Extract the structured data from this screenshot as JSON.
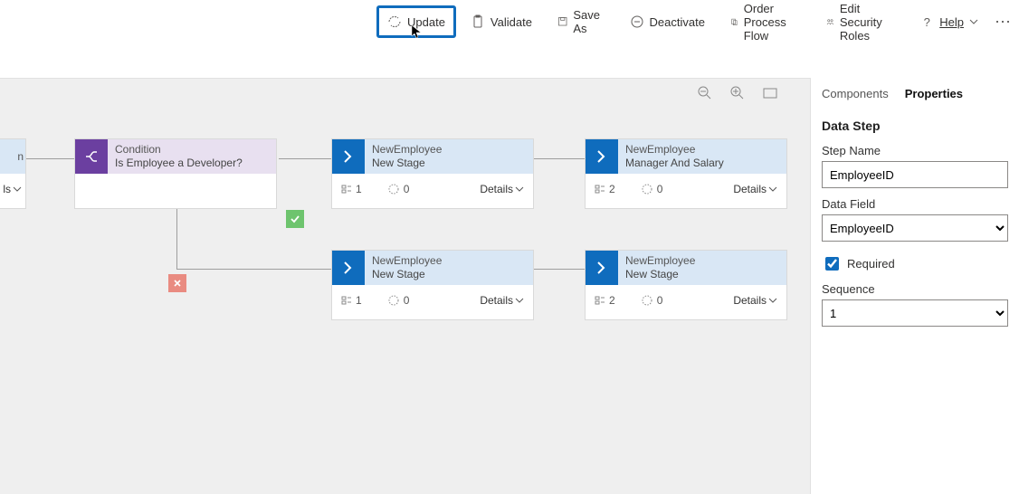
{
  "toolbar": {
    "update": "Update",
    "validate": "Validate",
    "save_as": "Save As",
    "deactivate": "Deactivate",
    "order": "Order Process Flow",
    "edit_roles": "Edit Security Roles",
    "help": "Help"
  },
  "canvas": {
    "partial_details": "ls",
    "condition": {
      "title": "Condition",
      "subtitle": "Is Employee a Developer?"
    },
    "stage1": {
      "title": "NewEmployee",
      "subtitle": "New Stage",
      "steps": "1",
      "triggers": "0",
      "details": "Details"
    },
    "stage2": {
      "title": "NewEmployee",
      "subtitle": "Manager And Salary",
      "steps": "2",
      "triggers": "0",
      "details": "Details"
    },
    "stage3": {
      "title": "NewEmployee",
      "subtitle": "New Stage",
      "steps": "1",
      "triggers": "0",
      "details": "Details"
    },
    "stage4": {
      "title": "NewEmployee",
      "subtitle": "New Stage",
      "steps": "2",
      "triggers": "0",
      "details": "Details"
    }
  },
  "panel": {
    "tab_components": "Components",
    "tab_properties": "Properties",
    "section": "Data Step",
    "step_name_label": "Step Name",
    "step_name_value": "EmployeeID",
    "data_field_label": "Data Field",
    "data_field_value": "EmployeeID",
    "required_label": "Required",
    "sequence_label": "Sequence",
    "sequence_value": "1"
  }
}
